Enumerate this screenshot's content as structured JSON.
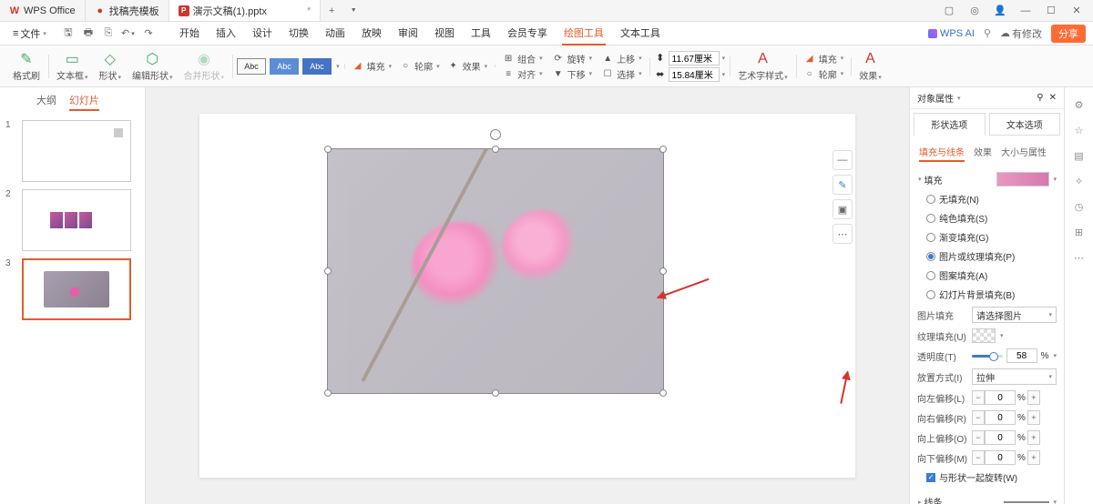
{
  "title_tabs": [
    {
      "icon": "W",
      "icon_color": "#d4342c",
      "label": "WPS Office"
    },
    {
      "icon": "●",
      "icon_color": "#d4342c",
      "label": "找稿壳模板"
    },
    {
      "icon": "P",
      "icon_color": "#d4342c",
      "label": "演示文稿(1).pptx",
      "dirty": "*"
    }
  ],
  "menu": {
    "file": "文件",
    "items": [
      "开始",
      "插入",
      "设计",
      "切换",
      "动画",
      "放映",
      "审阅",
      "视图",
      "工具",
      "会员专享",
      "绘图工具",
      "文本工具"
    ],
    "active_idx": 10,
    "wps_ai": "WPS AI",
    "changes": "有修改",
    "share": "分享"
  },
  "toolbar": {
    "format_brush": "格式刷",
    "textbox": "文本框",
    "shape": "形状",
    "edit_shape": "编辑形状",
    "merge_shape": "合并形状",
    "abc": "Abc",
    "fill": "填充",
    "outline": "轮廓",
    "effect": "效果",
    "group": "组合",
    "rotate": "旋转",
    "align": "对齐",
    "move_up": "上移",
    "move_down": "下移",
    "select": "选择",
    "width": "11.67厘米",
    "height": "15.84厘米",
    "art_style": "艺术字样式",
    "fill2": "填充",
    "outline2": "轮廓",
    "effect2": "效果"
  },
  "thumbs": {
    "tabs": [
      "大纲",
      "幻灯片"
    ],
    "active": 1
  },
  "prop": {
    "title": "对象属性",
    "tabs": [
      "形状选项",
      "文本选项"
    ],
    "subtabs": [
      "填充与线条",
      "效果",
      "大小与属性"
    ],
    "fill_section": "填充",
    "fill_opts": [
      "无填充(N)",
      "纯色填充(S)",
      "渐变填充(G)",
      "图片或纹理填充(P)",
      "图案填充(A)",
      "幻灯片背景填充(B)"
    ],
    "fill_checked": 3,
    "pic_fill": "图片填充",
    "pic_select": "请选择图片",
    "tex_fill": "纹理填充(U)",
    "opacity": "透明度(T)",
    "opacity_val": "58",
    "pct": "%",
    "tile": "放置方式(I)",
    "tile_val": "拉伸",
    "off_l": "向左偏移(L)",
    "off_r": "向右偏移(R)",
    "off_t": "向上偏移(O)",
    "off_b": "向下偏移(M)",
    "off_val": "0",
    "rotate_with": "与形状一起旋转(W)",
    "line_section": "线条"
  }
}
